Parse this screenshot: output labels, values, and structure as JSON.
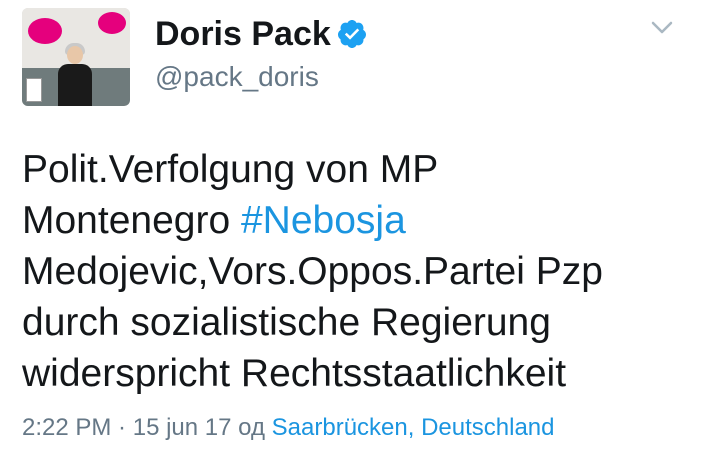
{
  "user": {
    "display_name": "Doris Pack",
    "handle": "@pack_doris",
    "verified": true
  },
  "tweet": {
    "line1": "Polit.Verfolgung von MP",
    "line2_prefix": "Montenegro ",
    "hashtag": "#Nebosja",
    "line3": "Medojevic,Vors.Oppos.Partei Pzp",
    "line4": "durch sozialistische Regierung",
    "line5": "widerspricht Rechtsstaatlichkeit"
  },
  "meta": {
    "time": "2:22 PM",
    "separator": " · ",
    "date": "15 jun 17",
    "from_prefix": " од ",
    "location": "Saarbrücken, Deutschland"
  },
  "icons": {
    "verified": "verified-badge-icon",
    "menu": "chevron-down-icon"
  },
  "colors": {
    "link": "#1b95e0",
    "secondary": "#657786",
    "text": "#14171a",
    "brand_pink": "#e5007d"
  }
}
